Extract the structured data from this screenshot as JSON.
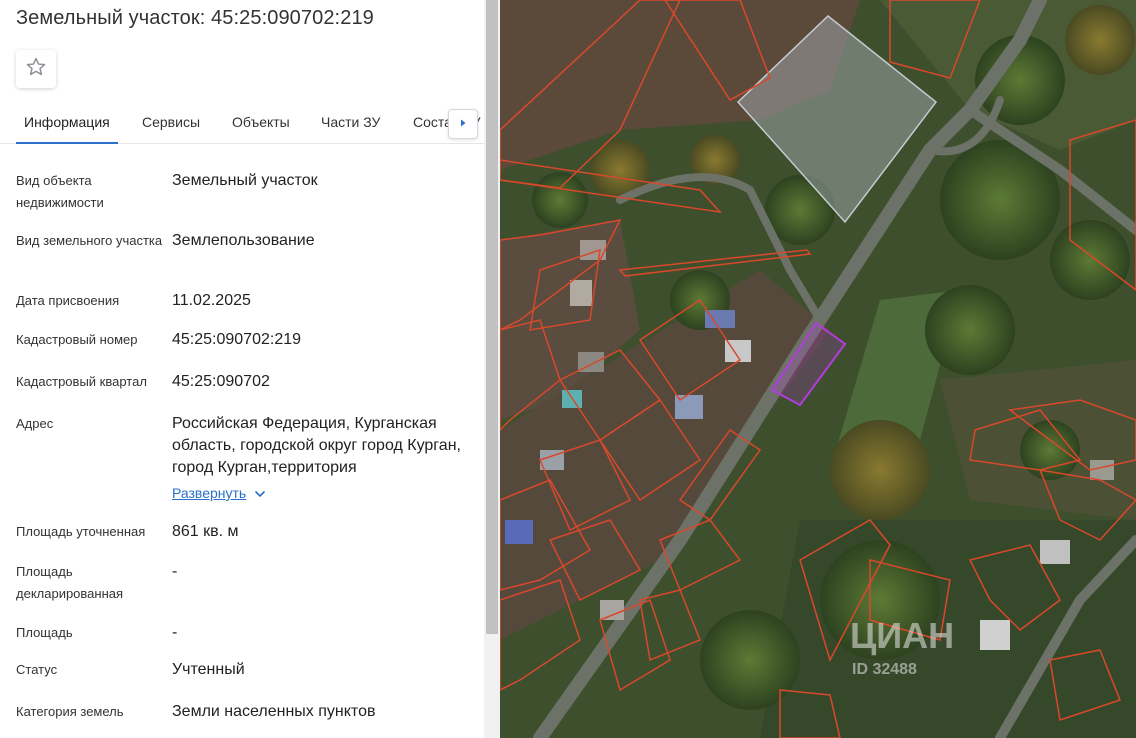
{
  "header": {
    "title": "Земельный участок: 45:25:090702:219",
    "favorite_icon": "star-outline-icon"
  },
  "tabs": [
    {
      "label": "Информация",
      "active": true
    },
    {
      "label": "Сервисы",
      "active": false
    },
    {
      "label": "Объекты",
      "active": false
    },
    {
      "label": "Части ЗУ",
      "active": false
    },
    {
      "label": "Состав ЗУ",
      "active": false
    }
  ],
  "tabs_next_icon": "chevron-right-icon",
  "info": {
    "object_type": {
      "label": "Вид объекта недвижимости",
      "value": "Земельный участок"
    },
    "land_type": {
      "label": "Вид земельного участка",
      "value": "Землепользование"
    },
    "assign_date": {
      "label": "Дата присвоения",
      "value": "11.02.2025"
    },
    "cadastral_number": {
      "label": "Кадастровый номер",
      "value": "45:25:090702:219"
    },
    "cadastral_block": {
      "label": "Кадастровый квартал",
      "value": "45:25:090702"
    },
    "address": {
      "label": "Адрес",
      "value": "Российская Федерация, Курганская область, городской округ город Курган, город Курган,территория",
      "expand_label": "Развернуть"
    },
    "area_specified": {
      "label": "Площадь уточненная",
      "value": "861 кв. м"
    },
    "area_declared": {
      "label": "Площадь декларированная",
      "value": "-"
    },
    "area": {
      "label": "Площадь",
      "value": "-"
    },
    "status": {
      "label": "Статус",
      "value": "Учтенный"
    },
    "land_category": {
      "label": "Категория земель",
      "value": "Земли населенных пунктов"
    }
  },
  "map": {
    "watermark": "ЦИАН",
    "watermark_id": "ID 32488",
    "colors": {
      "parcel_border": "#d9482b",
      "selected_parcel": "#b43cdc",
      "road": "#6c7268",
      "vegetation": "#3f5a2c"
    }
  }
}
